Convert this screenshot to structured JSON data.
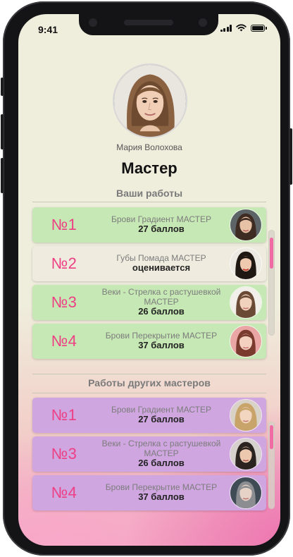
{
  "status": {
    "time": "9:41"
  },
  "profile": {
    "name": "Мария Волохова",
    "role": "Мастер"
  },
  "sections": {
    "mine": "Ваши работы",
    "others": "Работы других мастеров"
  },
  "my_works": [
    {
      "num": "№1",
      "name": "Брови Градиент МАСТЕР",
      "score": "27 баллов",
      "color": "#c6e8b4"
    },
    {
      "num": "№2",
      "name": "Губы Помада МАСТЕР",
      "score": "оценивается",
      "color": "#efebdf"
    },
    {
      "num": "№3",
      "name": "Веки - Стрелка с растушевкой МАСТЕР",
      "score": "26 баллов",
      "color": "#c6e8b4"
    },
    {
      "num": "№4",
      "name": "Брови Перекрытие МАСТЕР",
      "score": "37 баллов",
      "color": "#c6e8b4"
    }
  ],
  "other_works": [
    {
      "num": "№1",
      "name": "Брови Градиент МАСТЕР",
      "score": "27 баллов",
      "color": "#cfa6e0"
    },
    {
      "num": "№3",
      "name": "Веки - Стрелка с растушевкой МАСТЕР",
      "score": "26 баллов",
      "color": "#cfa6e0"
    },
    {
      "num": "№4",
      "name": "Брови Перекрытие МАСТЕР",
      "score": "37 баллов",
      "color": "#cfa6e0"
    }
  ],
  "colors": {
    "accent": "#ee3f84",
    "scroll_thumb": "#f06aa4",
    "own_card": "#c6e8b4",
    "pending_card": "#efebdf",
    "other_card": "#cfa6e0"
  }
}
